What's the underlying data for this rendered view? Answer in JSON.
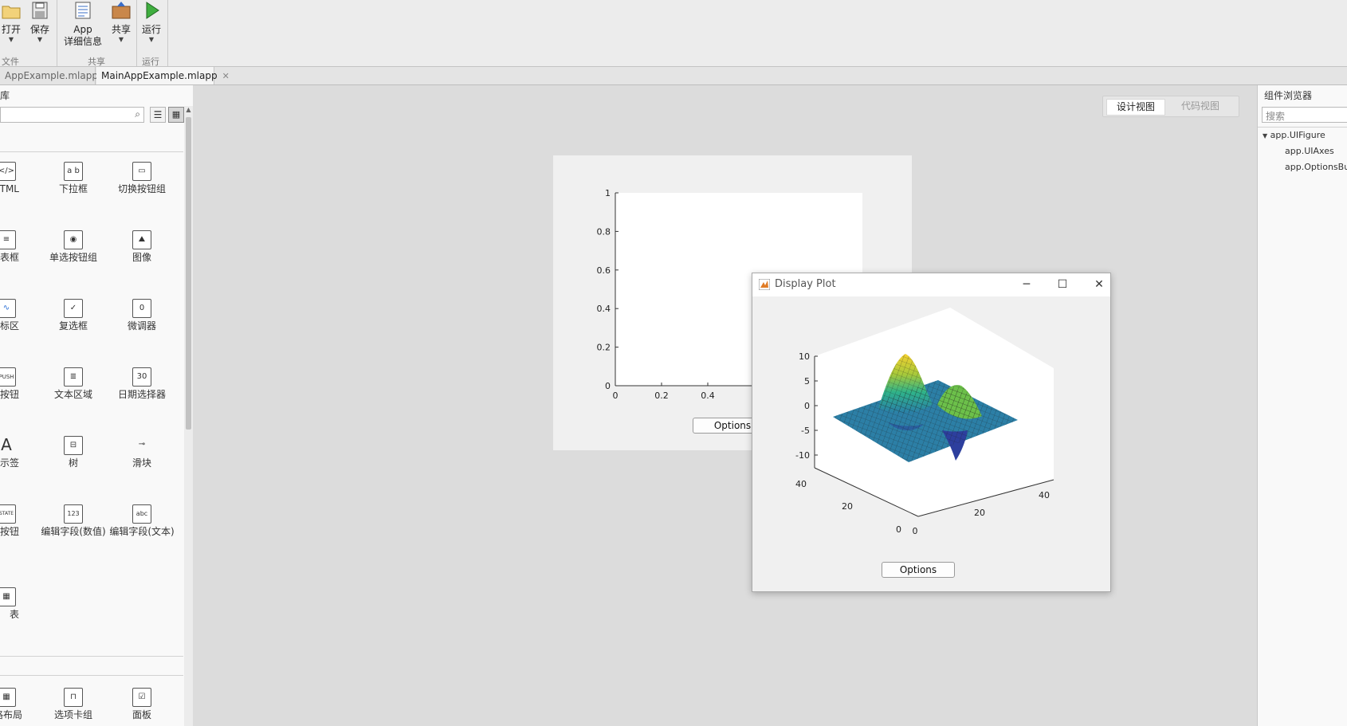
{
  "toolstrip": {
    "buttons": {
      "open": "打开",
      "save": "保存",
      "app_details_line1": "App",
      "app_details_line2": "详细信息",
      "share": "共享",
      "run": "运行"
    },
    "sections": {
      "file": "文件",
      "share": "共享",
      "run": "运行"
    }
  },
  "tabs": [
    {
      "label": "AppExample.mlapp",
      "active": false
    },
    {
      "label": "MainAppExample.mlapp",
      "active": true
    }
  ],
  "library": {
    "title": "库",
    "search_placeholder": "",
    "items": [
      {
        "label": "TML",
        "icon": "html-icon"
      },
      {
        "label": "下拉框",
        "icon": "dropdown-icon"
      },
      {
        "label": "切换按钮组",
        "icon": "toggle-button-group-icon"
      },
      {
        "label": "表框",
        "icon": "listbox-icon"
      },
      {
        "label": "单选按钮组",
        "icon": "radio-button-group-icon"
      },
      {
        "label": "图像",
        "icon": "image-icon"
      },
      {
        "label": "标区",
        "icon": "axes-icon"
      },
      {
        "label": "复选框",
        "icon": "checkbox-icon"
      },
      {
        "label": "微调器",
        "icon": "spinner-icon"
      },
      {
        "label": "按钮",
        "icon": "push-button-icon"
      },
      {
        "label": "文本区域",
        "icon": "text-area-icon"
      },
      {
        "label": "日期选择器",
        "icon": "date-picker-icon"
      },
      {
        "label": "示签",
        "icon": "label-icon"
      },
      {
        "label": "树",
        "icon": "tree-icon"
      },
      {
        "label": "滑块",
        "icon": "slider-icon"
      },
      {
        "label": "态按钮",
        "icon": "state-button-icon"
      },
      {
        "label": "编辑字段(数值)",
        "icon": "numeric-field-icon"
      },
      {
        "label": "编辑字段(文本)",
        "icon": "text-field-icon"
      },
      {
        "label": "表",
        "icon": "table-icon"
      }
    ],
    "containers": [
      {
        "label": "格布局",
        "icon": "grid-layout-icon"
      },
      {
        "label": "选项卡组",
        "icon": "tab-group-icon"
      },
      {
        "label": "面板",
        "icon": "panel-icon"
      }
    ]
  },
  "view_toggle": {
    "design": "设计视图",
    "code": "代码视图",
    "active": "design"
  },
  "app_figure": {
    "button_label": "Options",
    "y_ticks": [
      "0",
      "0.2",
      "0.4",
      "0.6",
      "0.8",
      "1"
    ],
    "x_ticks": [
      "0",
      "0.2",
      "0.4"
    ]
  },
  "figure_window": {
    "title": "Display Plot",
    "button_label": "Options",
    "z_ticks": [
      "10",
      "5",
      "0",
      "-5",
      "-10"
    ],
    "y_ticks": [
      "40",
      "20",
      "0"
    ],
    "x_ticks": [
      "0",
      "20",
      "40"
    ]
  },
  "component_browser": {
    "title": "组件浏览器",
    "search_placeholder": "搜索",
    "tree": [
      {
        "label": "app.UIFigure",
        "level": 0
      },
      {
        "label": "app.UIAxes",
        "level": 1
      },
      {
        "label": "app.OptionsBu",
        "level": 1
      }
    ]
  }
}
